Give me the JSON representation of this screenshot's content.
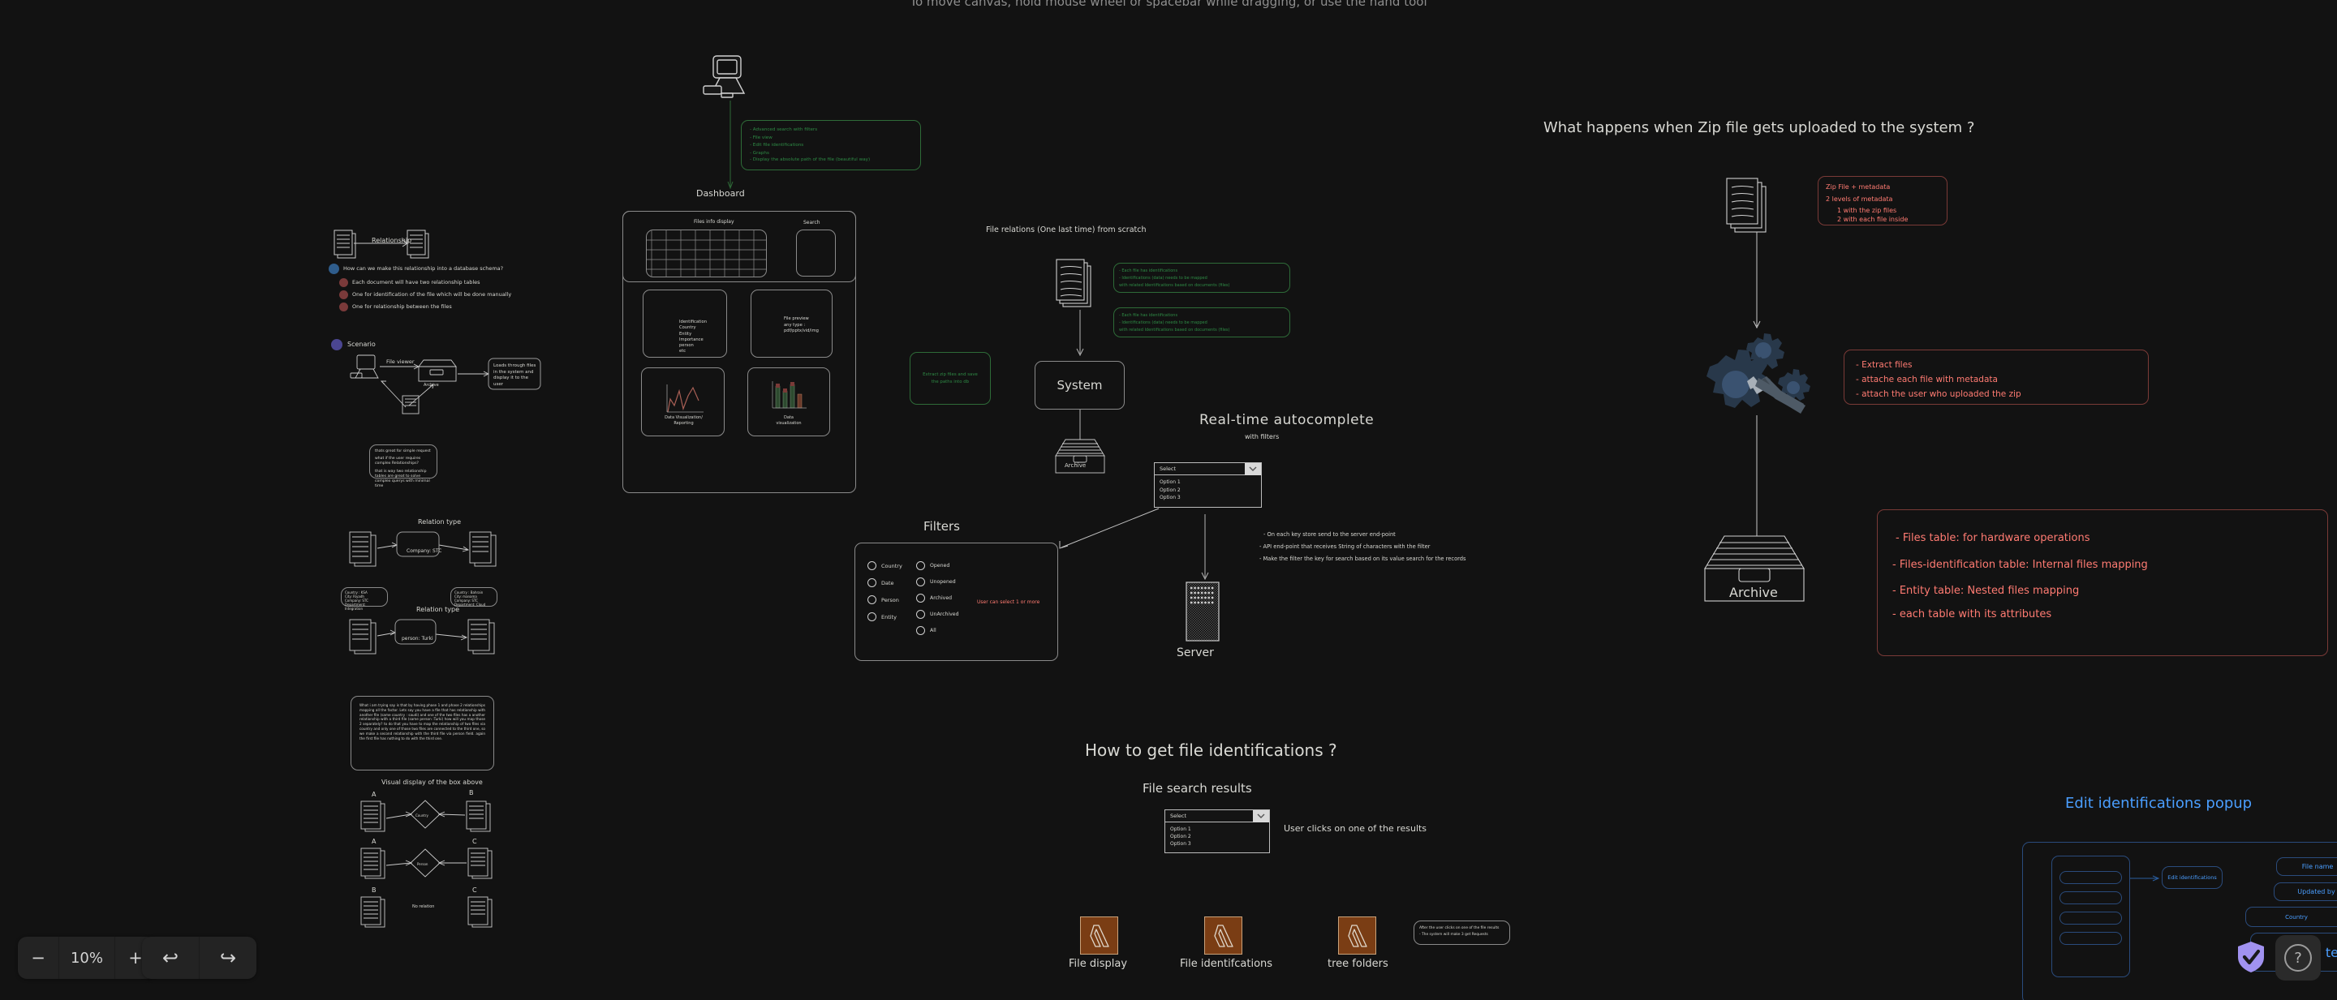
{
  "hint": {
    "text": "To move canvas, hold mouse wheel or spacebar while dragging, or use the hand tool"
  },
  "toolbar": {
    "zoom_out_label": "−",
    "zoom_level": "10%",
    "zoom_in_label": "+",
    "undo_label": "↩",
    "redo_label": "↪",
    "help_label": "?"
  },
  "left_panel": {
    "relationship_label": "Relationship",
    "question": "How can we make this relationship into a database schema?",
    "bullets": [
      "Each document will have two relationship tables",
      "One for identification of the file which will be done manually",
      "One for relationship between the files"
    ],
    "scenario_label": "Scenario",
    "scenario_edge": "File viewer",
    "scenario_archive": "Archive",
    "scenario_note": "Loads through files in the system and display it to the user",
    "note_box": [
      "thats great for simple request",
      "what if the user requires complex Relationships?",
      "that is way two relationship tables are great to solve complex querys with minimal time"
    ],
    "relation_type_label": "Relation type",
    "relation_company": "Company: STC",
    "relation_person": "person: Turki",
    "doc_attrs_left": [
      "Country : KSA",
      "City: Riyadh",
      "Company: STC",
      "Department: Integration"
    ],
    "doc_attrs_right": [
      "Country : Bahrain",
      "City: manama",
      "Company: STC",
      "Department: Cloud"
    ],
    "paragraph_box": "What i am trying say is that by having phase 1 and phase 2 relationships mapping all the factor. Lets say you have a file that has relationship with another file (same country : saudi) and one of the two files has a another relationship with a third file (same person :Turki) how will you map those 2 separately? to do that you have to map the relationship of two files via country and only one of those two files are connected to the third one, so we make a second relationship with the third file via person field. again the first file has nothing to do with the third one.",
    "visual_display_title": "Visual display of the box above",
    "pairs": [
      {
        "left": "A",
        "rel": "Country",
        "right": "B"
      },
      {
        "left": "A",
        "rel": "Person",
        "right": "C"
      },
      {
        "left": "B",
        "rel": "No relation",
        "right": "C"
      }
    ]
  },
  "dashboard": {
    "title": "Dashboard",
    "green_notes": [
      "- Advanced search with filters",
      "- File view",
      "- Edit file identifications",
      "- Graphs",
      "- Display the absolute path of the file (beautiful way)"
    ],
    "mock": {
      "files_info_label": "Files info display",
      "search_label": "Search",
      "identification_list": [
        "Identification",
        "Country",
        "Entity",
        "Importance",
        "person",
        "etc"
      ],
      "file_preview": [
        "File preview",
        "any type :",
        "pdf/pptx/vid/img"
      ],
      "data_viz_reporting": [
        "Data Visualization/",
        "Reporting"
      ],
      "data_viz": [
        "Data",
        "visualization"
      ]
    }
  },
  "file_relations": {
    "title": "File relations (One last time) from scratch",
    "green_note_1": [
      "- Each file has identifications",
      "- Identifications (data) needs to be mapped",
      "with related Identifications based on documents (files)"
    ],
    "green_note_2": [
      "- Each file has identifications",
      "- Identifications (data) needs to be mapped",
      "with related Identifications based on documents (files)"
    ],
    "extract_note": [
      "Extract zip files and save",
      "the paths into db"
    ],
    "system_label": "System",
    "archive_label": "Archive"
  },
  "autocomplete": {
    "title": "Real-time autocomplete",
    "subtitle": "with filters",
    "select_value": "Select",
    "options": [
      "Option 1",
      "Option 2",
      "Option 3"
    ],
    "server_label": "Server",
    "notes": [
      "- On each key store send to the server end-point",
      "- API end-point that receives String of characters with the filter",
      "- Make the filter the key for search based on its value search for the records"
    ]
  },
  "filters": {
    "title": "Filters",
    "column_a": [
      "Country",
      "Date",
      "Person",
      "Entity"
    ],
    "column_b": [
      "Opened",
      "Unopened",
      "Archived",
      "UnArchived",
      "All"
    ],
    "hint": "User can select 1 or more"
  },
  "zip_flow": {
    "title": "What happens when Zip file gets uploaded to the system ?",
    "archive_label": "Archive",
    "note_1": [
      "Zip File + metadata",
      "2 levels of metadata",
      "1 with the zip files",
      "2 with each file inside"
    ],
    "note_2": [
      "- Extract files",
      "- attache each file with metadata",
      "- attach the user who uploaded the zip"
    ],
    "note_3": [
      "- Files table: for hardware operations",
      "- Files-identification table: Internal files mapping",
      "- Entity table: Nested files mapping",
      "- each table with its attributes"
    ]
  },
  "identifications": {
    "title": "How to get file identifications ?",
    "results_title": "File search results",
    "select_value": "Select",
    "options": [
      "Option 1",
      "Option 2",
      "Option 3"
    ],
    "click_note": "User clicks on one of the results",
    "lambdas": [
      "File display",
      "File identifcations",
      "tree folders"
    ],
    "lambda_note": [
      "After the user clicks on one of the file results",
      "- The system will make 3 get Requests"
    ]
  },
  "popup": {
    "title": "Edit identifications popup",
    "edit_btn": "Edit identifications",
    "fields": [
      "File name",
      "Updated by",
      "Country"
    ],
    "cta": "te"
  },
  "colors": {
    "bg": "#121212",
    "ink": "#d8d8d3",
    "green": "#2e8b45",
    "red": "#ff7b72",
    "blue": "#4a9eff",
    "lambda": "#7a3d14",
    "accent": "#a192f0"
  }
}
